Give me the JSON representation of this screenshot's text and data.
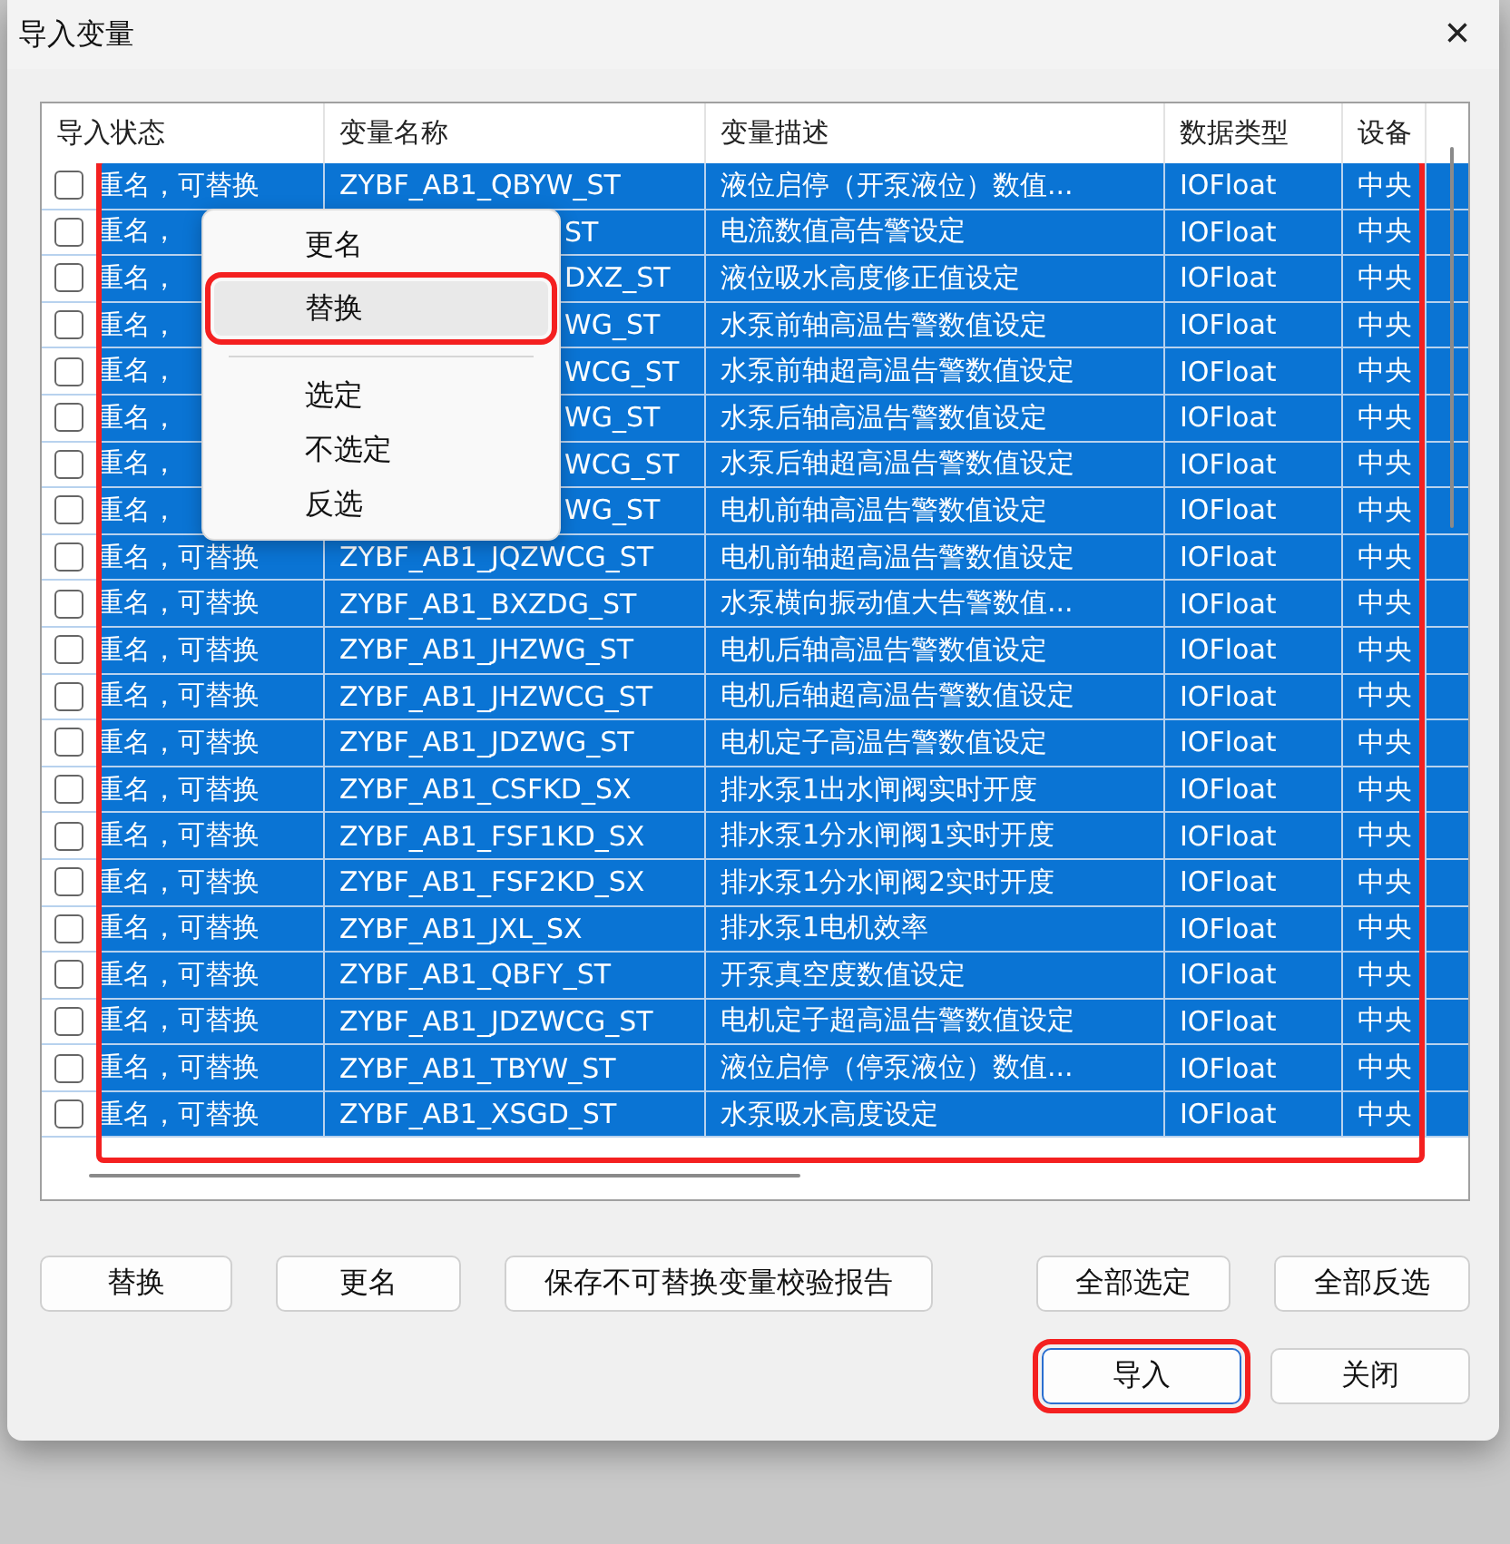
{
  "window": {
    "title": "导入变量",
    "close": "×"
  },
  "table": {
    "highlighted": true,
    "columns": [
      "导入状态",
      "变量名称",
      "变量描述",
      "数据类型",
      "设备"
    ],
    "rows": [
      {
        "checked": false,
        "selected": true,
        "covered": false,
        "status": "重名，可替换",
        "name": "ZYBF_AB1_QBYW_ST",
        "description": "液位启停（开泵液位）数值...",
        "type": "IOFloat",
        "device": "中央"
      },
      {
        "checked": false,
        "selected": true,
        "covered": true,
        "status": "重名，",
        "name": "ST",
        "description": "电流数值高告警设定",
        "type": "IOFloat",
        "device": "中央"
      },
      {
        "checked": false,
        "selected": true,
        "covered": true,
        "status": "重名，",
        "name": "DXZ_ST",
        "description": "液位吸水高度修正值设定",
        "type": "IOFloat",
        "device": "中央"
      },
      {
        "checked": false,
        "selected": true,
        "covered": true,
        "status": "重名，",
        "name": "WG_ST",
        "description": "水泵前轴高温告警数值设定",
        "type": "IOFloat",
        "device": "中央"
      },
      {
        "checked": false,
        "selected": true,
        "covered": true,
        "status": "重名，",
        "name": "WCG_ST",
        "description": "水泵前轴超高温告警数值设定",
        "type": "IOFloat",
        "device": "中央"
      },
      {
        "checked": false,
        "selected": true,
        "covered": true,
        "status": "重名，",
        "name": "WG_ST",
        "description": "水泵后轴高温告警数值设定",
        "type": "IOFloat",
        "device": "中央"
      },
      {
        "checked": false,
        "selected": true,
        "covered": true,
        "status": "重名，",
        "name": "WCG_ST",
        "description": "水泵后轴超高温告警数值设定",
        "type": "IOFloat",
        "device": "中央"
      },
      {
        "checked": false,
        "selected": true,
        "covered": true,
        "status": "重名，",
        "name": "WG_ST",
        "description": "电机前轴高温告警数值设定",
        "type": "IOFloat",
        "device": "中央"
      },
      {
        "checked": false,
        "selected": true,
        "covered": false,
        "status": "重名，可替换",
        "name": "ZYBF_AB1_JQZWCG_ST",
        "description": "电机前轴超高温告警数值设定",
        "type": "IOFloat",
        "device": "中央"
      },
      {
        "checked": false,
        "selected": true,
        "covered": false,
        "status": "重名，可替换",
        "name": "ZYBF_AB1_BXZDG_ST",
        "description": "水泵横向振动值大告警数值...",
        "type": "IOFloat",
        "device": "中央"
      },
      {
        "checked": false,
        "selected": true,
        "covered": false,
        "status": "重名，可替换",
        "name": "ZYBF_AB1_JHZWG_ST",
        "description": "电机后轴高温告警数值设定",
        "type": "IOFloat",
        "device": "中央"
      },
      {
        "checked": false,
        "selected": true,
        "covered": false,
        "status": "重名，可替换",
        "name": "ZYBF_AB1_JHZWCG_ST",
        "description": "电机后轴超高温告警数值设定",
        "type": "IOFloat",
        "device": "中央"
      },
      {
        "checked": false,
        "selected": true,
        "covered": false,
        "status": "重名，可替换",
        "name": "ZYBF_AB1_JDZWG_ST",
        "description": "电机定子高温告警数值设定",
        "type": "IOFloat",
        "device": "中央"
      },
      {
        "checked": false,
        "selected": true,
        "covered": false,
        "status": "重名，可替换",
        "name": "ZYBF_AB1_CSFKD_SX",
        "description": "排水泵1出水闸阀实时开度",
        "type": "IOFloat",
        "device": "中央"
      },
      {
        "checked": false,
        "selected": true,
        "covered": false,
        "status": "重名，可替换",
        "name": "ZYBF_AB1_FSF1KD_SX",
        "description": "排水泵1分水闸阀1实时开度",
        "type": "IOFloat",
        "device": "中央"
      },
      {
        "checked": false,
        "selected": true,
        "covered": false,
        "status": "重名，可替换",
        "name": "ZYBF_AB1_FSF2KD_SX",
        "description": "排水泵1分水闸阀2实时开度",
        "type": "IOFloat",
        "device": "中央"
      },
      {
        "checked": false,
        "selected": true,
        "covered": false,
        "status": "重名，可替换",
        "name": "ZYBF_AB1_JXL_SX",
        "description": "排水泵1电机效率",
        "type": "IOFloat",
        "device": "中央"
      },
      {
        "checked": false,
        "selected": true,
        "covered": false,
        "status": "重名，可替换",
        "name": "ZYBF_AB1_QBFY_ST",
        "description": "开泵真空度数值设定",
        "type": "IOFloat",
        "device": "中央"
      },
      {
        "checked": false,
        "selected": true,
        "covered": false,
        "status": "重名，可替换",
        "name": "ZYBF_AB1_JDZWCG_ST",
        "description": "电机定子超高温告警数值设定",
        "type": "IOFloat",
        "device": "中央"
      },
      {
        "checked": false,
        "selected": true,
        "covered": false,
        "status": "重名，可替换",
        "name": "ZYBF_AB1_TBYW_ST",
        "description": "液位启停（停泵液位）数值...",
        "type": "IOFloat",
        "device": "中央"
      },
      {
        "checked": false,
        "selected": true,
        "covered": false,
        "status": "重名，可替换",
        "name": "ZYBF_AB1_XSGD_ST",
        "description": "水泵吸水高度设定",
        "type": "IOFloat",
        "device": "中央"
      }
    ]
  },
  "context_menu": [
    {
      "kind": "item",
      "label": "更名",
      "hovered": false,
      "highlighted": false
    },
    {
      "kind": "item",
      "label": "替换",
      "hovered": true,
      "highlighted": true
    },
    {
      "kind": "separator"
    },
    {
      "kind": "item",
      "label": "选定",
      "hovered": false,
      "highlighted": false
    },
    {
      "kind": "item",
      "label": "不选定",
      "hovered": false,
      "highlighted": false
    },
    {
      "kind": "item",
      "label": "反选",
      "hovered": false,
      "highlighted": false
    }
  ],
  "action_buttons": [
    {
      "label": "替换"
    },
    {
      "label": "更名"
    },
    {
      "label": "保存不可替换变量校验报告"
    },
    {
      "label": "全部选定"
    },
    {
      "label": "全部反选"
    }
  ],
  "dialog_buttons": [
    {
      "label": "导入",
      "default": true,
      "highlighted": true
    },
    {
      "label": "关闭",
      "default": false,
      "highlighted": false
    }
  ]
}
